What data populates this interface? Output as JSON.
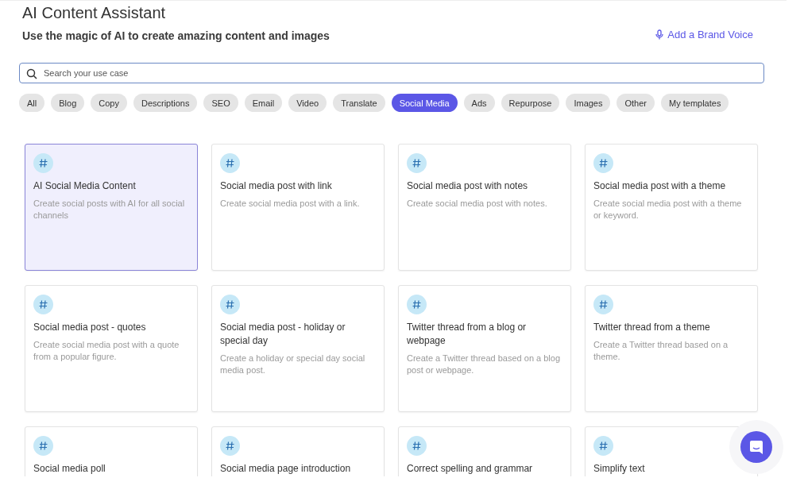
{
  "header": {
    "title": "AI Content Assistant",
    "subtitle": "Use the magic of AI to create amazing content and images",
    "brand_voice_link": "Add a Brand Voice"
  },
  "search": {
    "placeholder": "Search your use case"
  },
  "filters": [
    {
      "label": "All",
      "selected": false
    },
    {
      "label": "Blog",
      "selected": false
    },
    {
      "label": "Copy",
      "selected": false
    },
    {
      "label": "Descriptions",
      "selected": false
    },
    {
      "label": "SEO",
      "selected": false
    },
    {
      "label": "Email",
      "selected": false
    },
    {
      "label": "Video",
      "selected": false
    },
    {
      "label": "Translate",
      "selected": false
    },
    {
      "label": "Social Media",
      "selected": true
    },
    {
      "label": "Ads",
      "selected": false
    },
    {
      "label": "Repurpose",
      "selected": false
    },
    {
      "label": "Images",
      "selected": false
    },
    {
      "label": "Other",
      "selected": false
    },
    {
      "label": "My templates",
      "selected": false
    }
  ],
  "cards": [
    {
      "title": "AI Social Media Content",
      "description": "Create social posts with AI for all social channels",
      "selected": true
    },
    {
      "title": "Social media post with link",
      "description": "Create social media post with a link.",
      "selected": false
    },
    {
      "title": "Social media post with notes",
      "description": "Create social media post with notes.",
      "selected": false
    },
    {
      "title": "Social media post with a theme",
      "description": "Create social media post with a theme or keyword.",
      "selected": false
    },
    {
      "title": "Social media post - quotes",
      "description": "Create social media post with a quote from a popular figure.",
      "selected": false
    },
    {
      "title": "Social media post - holiday or special day",
      "description": "Create a holiday or special day social media post.",
      "selected": false
    },
    {
      "title": "Twitter thread from a blog or webpage",
      "description": "Create a Twitter thread based on a blog post or webpage.",
      "selected": false
    },
    {
      "title": "Twitter thread from a theme",
      "description": "Create a Twitter thread based on a theme.",
      "selected": false
    },
    {
      "title": "Social media poll",
      "selected": false
    },
    {
      "title": "Social media page introduction",
      "selected": false
    },
    {
      "title": "Correct spelling and grammar",
      "selected": false
    },
    {
      "title": "Simplify text",
      "selected": false
    }
  ]
}
